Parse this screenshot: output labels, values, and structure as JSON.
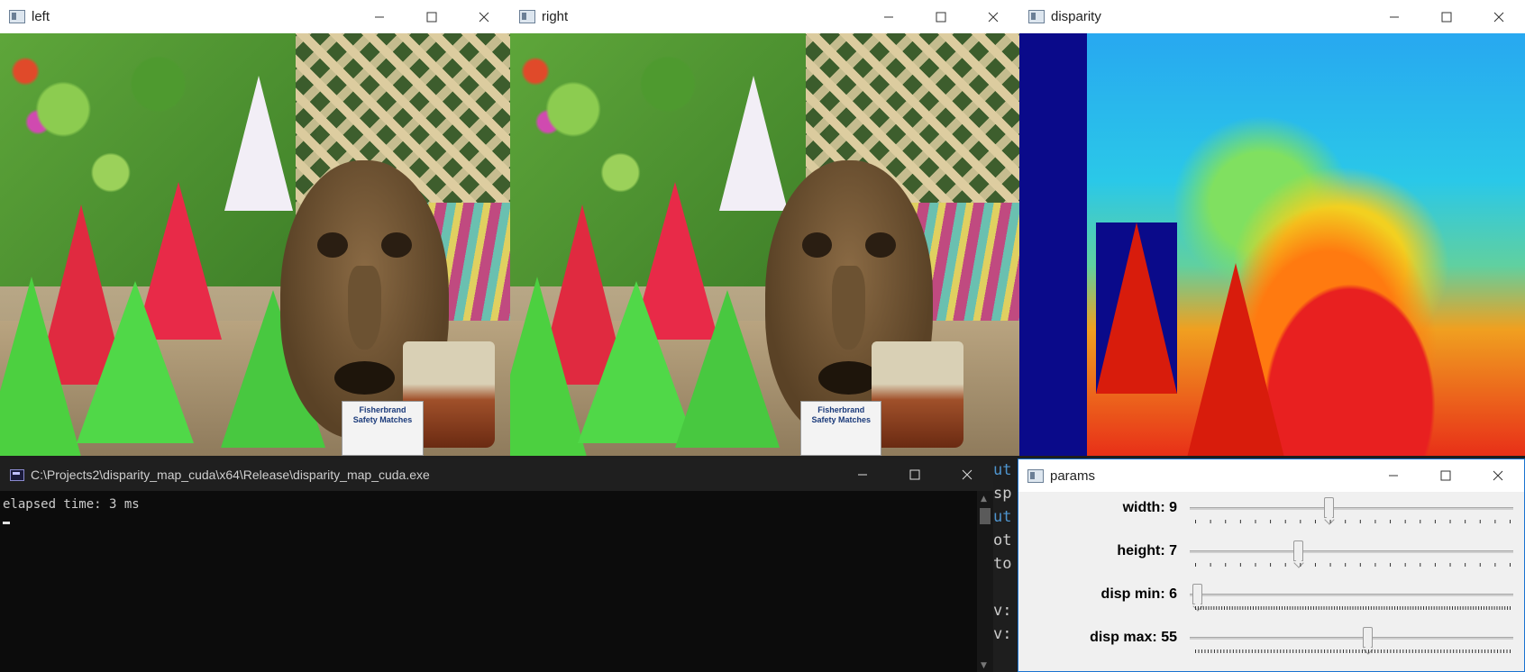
{
  "windows": {
    "left": {
      "title": "left"
    },
    "right": {
      "title": "right"
    },
    "disparity": {
      "title": "disparity"
    },
    "console": {
      "title": "C:\\Projects2\\disparity_map_cuda\\x64\\Release\\disparity_map_cuda.exe",
      "output": "elapsed time: 3 ms"
    },
    "params": {
      "title": "params",
      "sliders": [
        {
          "label": "width: 9",
          "value": 9,
          "max": 21
        },
        {
          "label": "height: 7",
          "value": 7,
          "max": 21
        },
        {
          "label": "disp min: 6",
          "value": 6,
          "max": 255
        },
        {
          "label": "disp max: 55",
          "value": 55,
          "max": 100
        }
      ]
    }
  },
  "background_editor": {
    "lines": [
      "ut",
      "sp",
      "ut",
      "ot",
      "to",
      "",
      "v:",
      "v:"
    ],
    "colors": [
      "#4e94ce",
      "#cccccc",
      "#4e94ce",
      "#cccccc",
      "#cccccc",
      "#cccccc",
      "#cccccc",
      "#cccccc"
    ]
  },
  "scene_box_text": [
    "Fisherbrand",
    "Safety Matches"
  ],
  "window_controls": {
    "minimize": "—",
    "maximize": "☐",
    "close": "✕"
  }
}
